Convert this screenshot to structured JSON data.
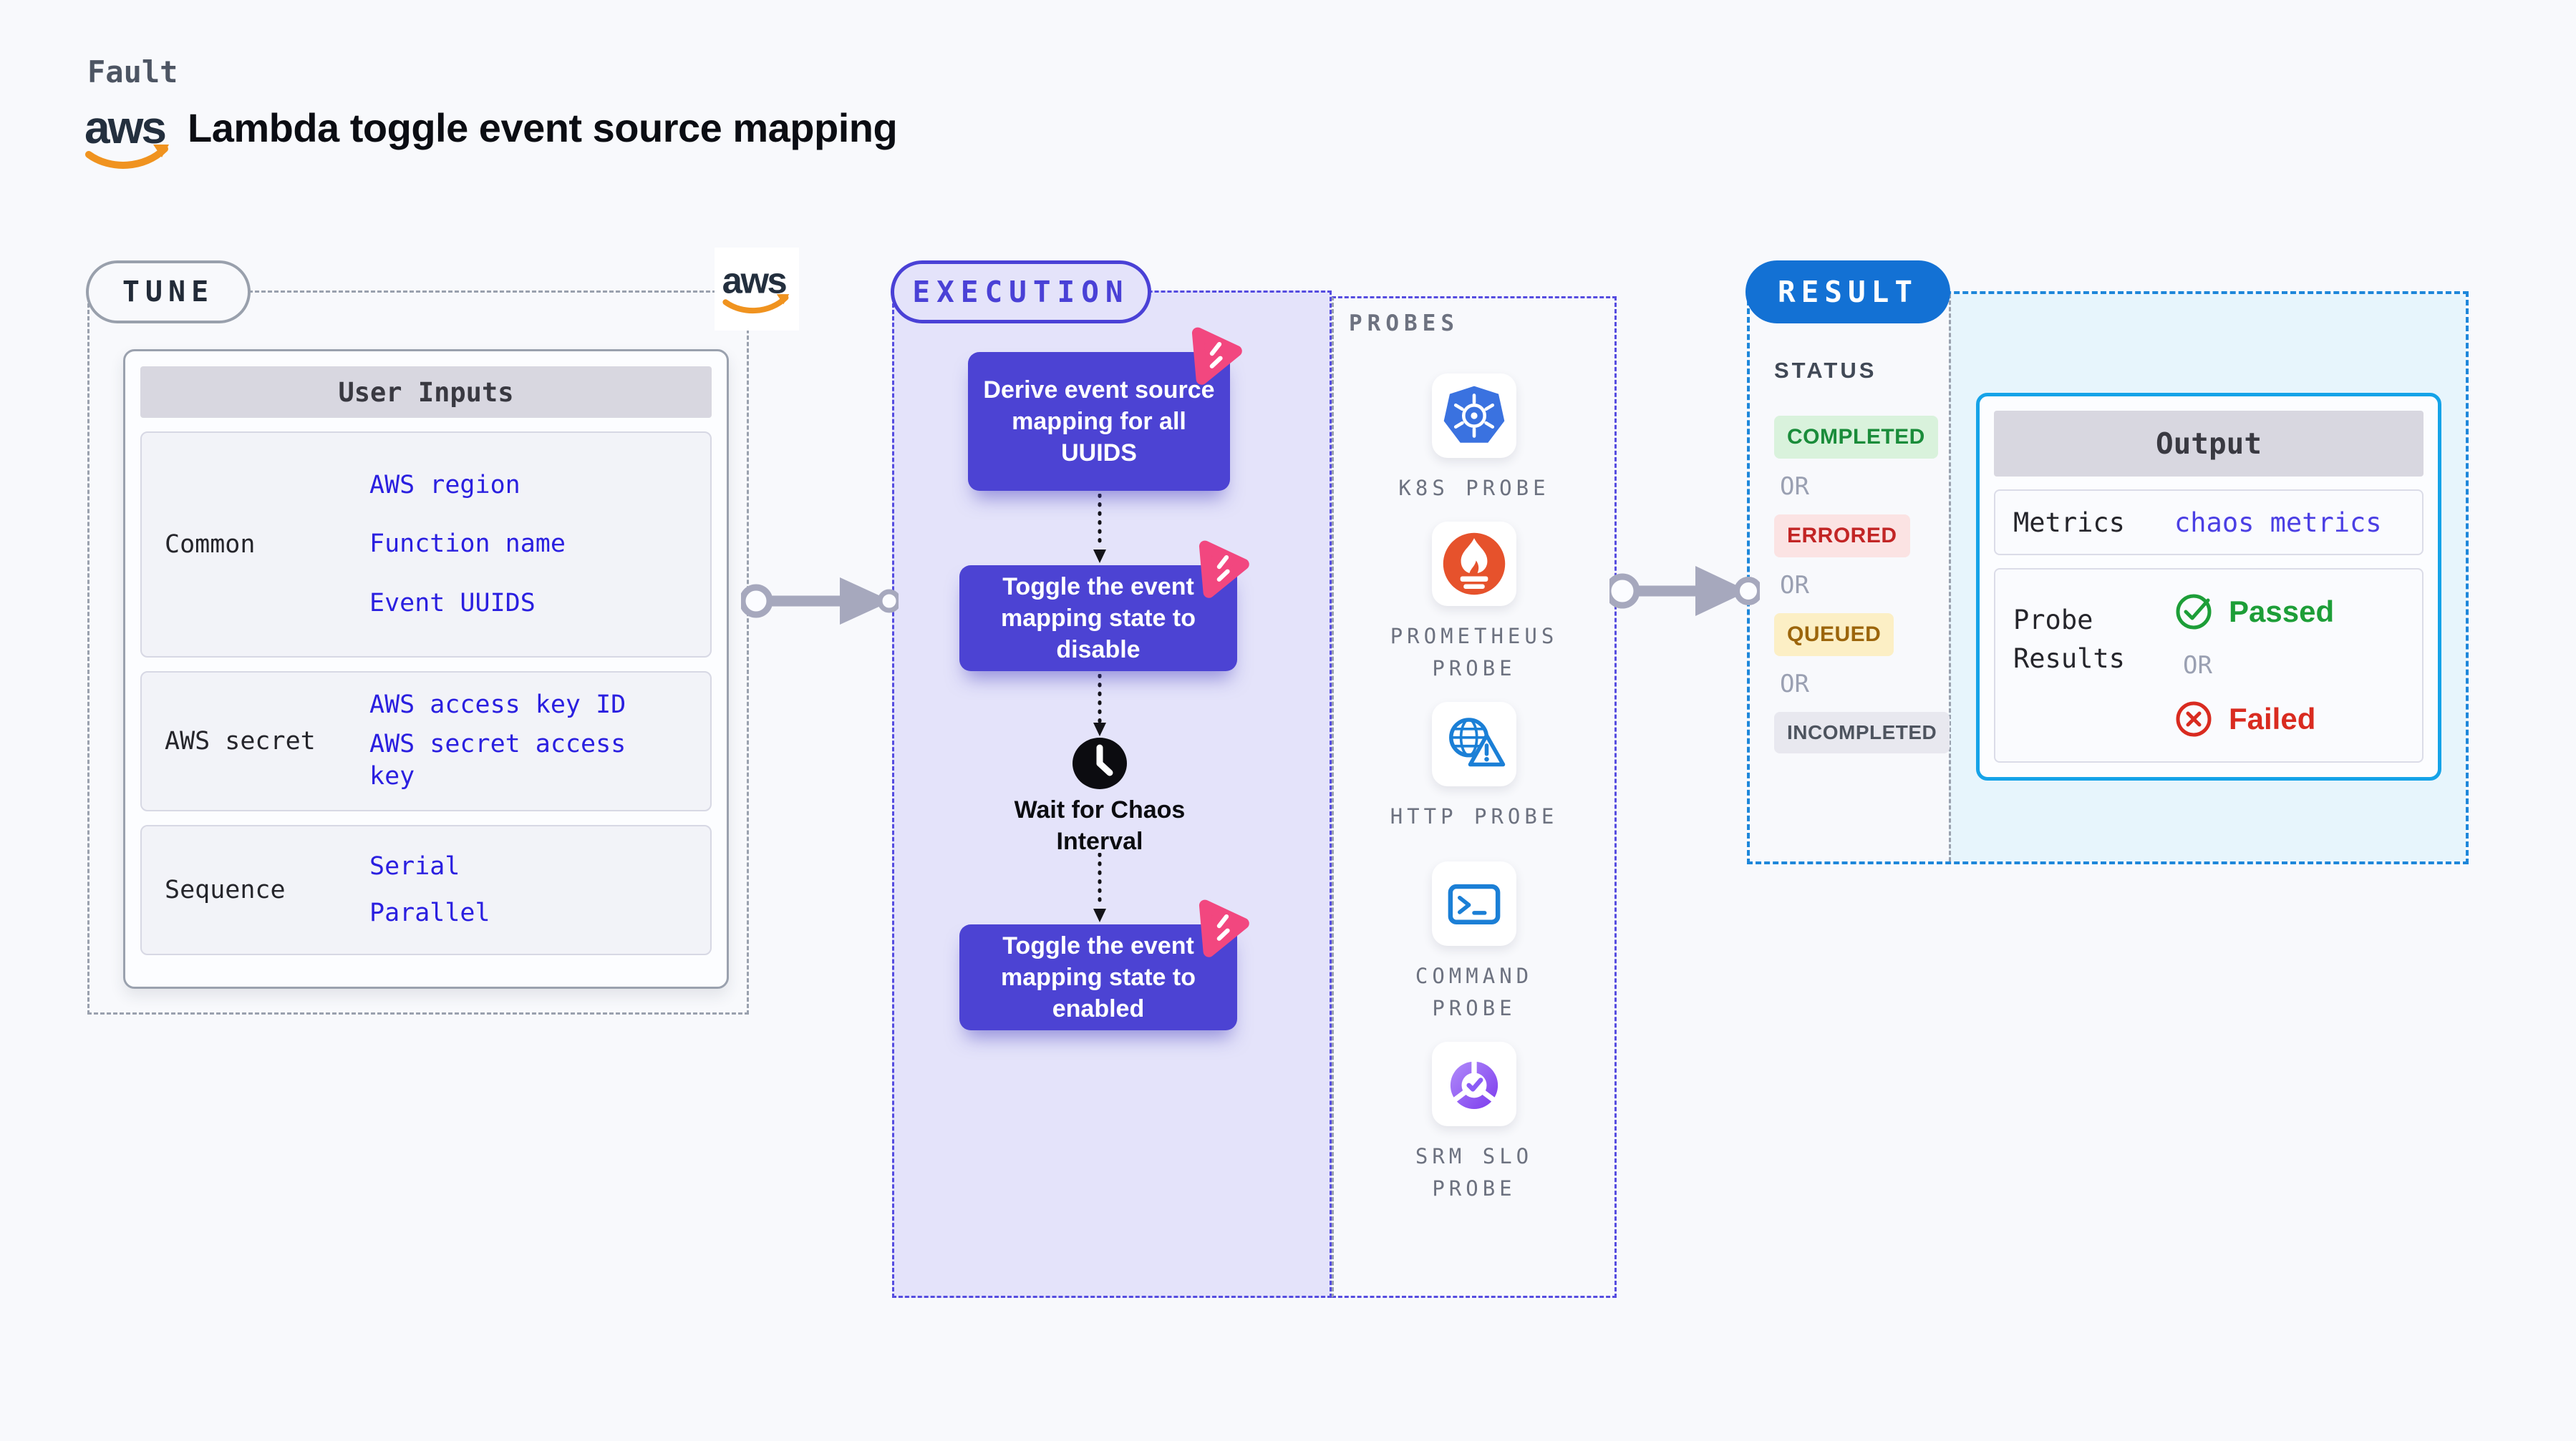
{
  "header": {
    "fault_label": "Fault",
    "title": "Lambda toggle event source mapping",
    "aws_logo_text": "aws"
  },
  "tune": {
    "pill": "TUNE",
    "table_title": "User Inputs",
    "groups": [
      {
        "label": "Common",
        "values": [
          "AWS region",
          "Function name",
          "Event UUIDS"
        ]
      },
      {
        "label": "AWS secret",
        "values": [
          "AWS access key ID",
          "AWS secret access key"
        ]
      },
      {
        "label": "Sequence",
        "values": [
          "Serial",
          "Parallel"
        ]
      }
    ]
  },
  "execution": {
    "pill": "EXECUTION",
    "steps": [
      "Derive event source mapping for all UUIDS",
      "Toggle the event mapping state to disable",
      "Toggle the event mapping state to enabled"
    ],
    "wait_label": "Wait for Chaos Interval"
  },
  "probes": {
    "label": "PROBES",
    "items": [
      {
        "name": "K8S PROBE",
        "icon": "kubernetes-icon"
      },
      {
        "name": "PROMETHEUS PROBE",
        "icon": "prometheus-icon"
      },
      {
        "name": "HTTP PROBE",
        "icon": "http-globe-icon"
      },
      {
        "name": "COMMAND PROBE",
        "icon": "terminal-icon"
      },
      {
        "name": "SRM SLO PROBE",
        "icon": "slo-pie-icon"
      }
    ]
  },
  "result": {
    "pill": "RESULT",
    "status_label": "STATUS",
    "or_label": "OR",
    "statuses": [
      {
        "label": "COMPLETED",
        "type": "success"
      },
      {
        "label": "ERRORED",
        "type": "error"
      },
      {
        "label": "QUEUED",
        "type": "warning"
      },
      {
        "label": "INCOMPLETED",
        "type": "neutral"
      }
    ],
    "output": {
      "title": "Output",
      "metrics_label": "Metrics",
      "metrics_value": "chaos metrics",
      "probe_results_label": "Probe Results",
      "passed_label": "Passed",
      "failed_label": "Failed",
      "or_label": "OR"
    }
  },
  "colors": {
    "indigo_accent": "#4a41d6",
    "node_purple": "#4c43d3",
    "result_blue": "#1371d4",
    "result_border_blue": "#1e87da",
    "output_border_cyan": "#15a3e8",
    "value_blue": "#2a1fe0",
    "passed_green": "#1d9e38",
    "failed_red": "#d92b20",
    "queued_amber": "#9c650b",
    "aws_orange": "#f0931f",
    "litmus_pink": "#f2477f",
    "arrow_gray": "#a6a8bd"
  }
}
